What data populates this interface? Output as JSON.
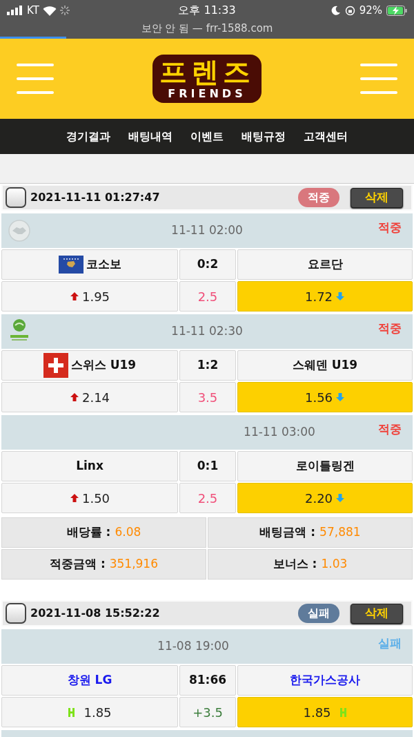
{
  "status_bar": {
    "carrier": "KT",
    "time": "오후 11:33",
    "battery": "92%"
  },
  "address_bar": {
    "text": "보안 안 됨 — frr-1588.com",
    "level": 0.16
  },
  "logo": {
    "title": "프렌즈",
    "subtitle": "FRIENDS"
  },
  "nav": [
    "경기결과",
    "배팅내역",
    "이벤트",
    "배팅규정",
    "고객센터"
  ],
  "bets": [
    {
      "date": "2021-11-11 01:27:47",
      "checked": false,
      "status": {
        "label": "적중",
        "kind": "hit"
      },
      "delete": "삭제",
      "matches": [
        {
          "time": "11-11 02:00",
          "league_logo": {
            "kind": "handshake"
          },
          "result": {
            "label": "적중",
            "kind": "hit"
          },
          "kind": "over_under",
          "home": {
            "name": "코소보",
            "flag": {
              "kind": "kosovo"
            },
            "color": "#111111"
          },
          "score": "0:2",
          "away": {
            "name": "요르단",
            "color": "#111111"
          },
          "home_odds": {
            "value": "1.95",
            "selected": false
          },
          "line": "2.5",
          "away_odds": {
            "value": "1.72",
            "selected": true
          }
        },
        {
          "time": "11-11 02:30",
          "league_logo": {
            "kind": "u19"
          },
          "result": {
            "label": "적중",
            "kind": "hit"
          },
          "kind": "over_under",
          "home": {
            "name": "스위스 U19",
            "flag": {
              "kind": "swiss"
            },
            "color": "#111111"
          },
          "score": "1:2",
          "away": {
            "name": "스웨덴 U19",
            "color": "#111111"
          },
          "home_odds": {
            "value": "2.14",
            "selected": false
          },
          "line": "3.5",
          "away_odds": {
            "value": "1.56",
            "selected": true
          }
        },
        {
          "time": "11-11 03:00",
          "result": {
            "label": "적중",
            "kind": "hit"
          },
          "kind": "over_under",
          "home": {
            "name": "Linx",
            "color": "#111111"
          },
          "score": "0:1",
          "away": {
            "name": "로이틀링겐",
            "color": "#111111"
          },
          "home_odds": {
            "value": "1.50",
            "selected": false
          },
          "line": "2.5",
          "away_odds": {
            "value": "2.20",
            "selected": true
          }
        }
      ],
      "summary": [
        {
          "label": "배당률 :",
          "value": "6.08"
        },
        {
          "label": "배팅금액 :",
          "value": "57,881"
        },
        {
          "label": "적중금액 :",
          "value": "351,916"
        },
        {
          "label": "보너스 :",
          "value": "1.03"
        }
      ]
    },
    {
      "date": "2021-11-08 15:52:22",
      "checked": false,
      "status": {
        "label": "실패",
        "kind": "fail"
      },
      "delete": "삭제",
      "matches": [
        {
          "time": "11-08 19:00",
          "result": {
            "label": "실패",
            "kind": "fail"
          },
          "kind": "handicap",
          "home": {
            "name": "창원 LG",
            "color": "#1a1aee"
          },
          "score": "81:66",
          "away": {
            "name": "한국가스공사",
            "color": "#1a1aee"
          },
          "home_odds": {
            "value": "1.85",
            "selected": false
          },
          "line": "+3.5",
          "away_odds": {
            "value": "1.85",
            "selected": true
          }
        }
      ]
    }
  ]
}
